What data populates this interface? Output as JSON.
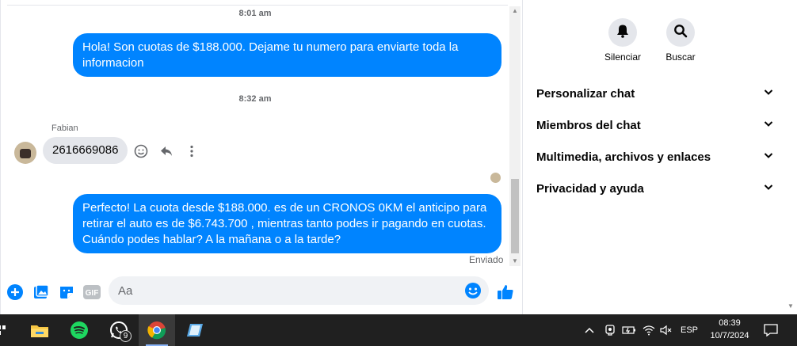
{
  "chat": {
    "messages": [
      {
        "type": "time",
        "text": "8:01 am"
      },
      {
        "type": "outgoing",
        "text": "Hola! Son cuotas de $188.000. Dejame tu numero para enviarte toda la informacion"
      },
      {
        "type": "time",
        "text": "8:32 am"
      },
      {
        "type": "incoming",
        "sender": "Fabian",
        "text": "2616669086"
      },
      {
        "type": "outgoing",
        "text": "Perfecto! La cuota desde $188.000. es de un CRONOS 0KM el anticipo para retirar el auto es de $6.743.700 , mientras tanto podes ir pagando en cuotas. Cuándo podes hablar? A la mañana o a la tarde?"
      }
    ],
    "status": "Enviado",
    "composer": {
      "placeholder": "Aa"
    }
  },
  "side": {
    "actions": [
      {
        "label": "Silenciar",
        "icon": "bell-icon"
      },
      {
        "label": "Buscar",
        "icon": "search-icon"
      }
    ],
    "sections": [
      {
        "label": "Personalizar chat"
      },
      {
        "label": "Miembros del chat"
      },
      {
        "label": "Multimedia, archivos y enlaces"
      },
      {
        "label": "Privacidad y ayuda"
      }
    ]
  },
  "taskbar": {
    "whatsapp_badge": "9",
    "language": "ESP",
    "time": "08:39",
    "date": "10/7/2024"
  },
  "colors": {
    "accent": "#0084ff",
    "incoming_bubble": "#e4e6eb",
    "taskbar": "#202020"
  }
}
